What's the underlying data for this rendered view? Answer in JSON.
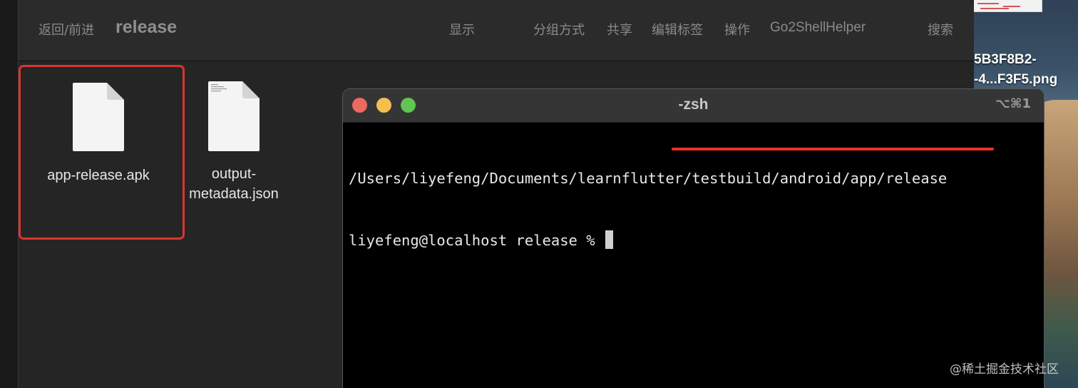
{
  "desktop": {
    "file_label_line1": "5B3F8B2-",
    "file_label_line2": "-4...F3F5.png",
    "watermark": "@稀土掘金技术社区"
  },
  "finder": {
    "nav_back_forward": "返回/前进",
    "title": "release",
    "toolbar": {
      "display": "显示",
      "group_by": "分组方式",
      "share": "共享",
      "edit_tags": "编辑标签",
      "actions": "操作",
      "go2shell": "Go2ShellHelper",
      "search": "搜索"
    },
    "files": [
      {
        "name": "app-release.apk",
        "selected": true
      },
      {
        "name_line1": "output-",
        "name_line2": "metadata.json"
      }
    ],
    "highlight_color": "#d9362f"
  },
  "terminal": {
    "title": "-zsh",
    "shortcut": "⌥⌘1",
    "lines": [
      "/Users/liyefeng/Documents/learnflutter/testbuild/android/app/release",
      "liyefeng@localhost release % "
    ],
    "underline_color": "#e8312b",
    "traffic_lights": {
      "close": "#ed6a5e",
      "minimize": "#f5bf4f",
      "maximize": "#61c554"
    }
  }
}
